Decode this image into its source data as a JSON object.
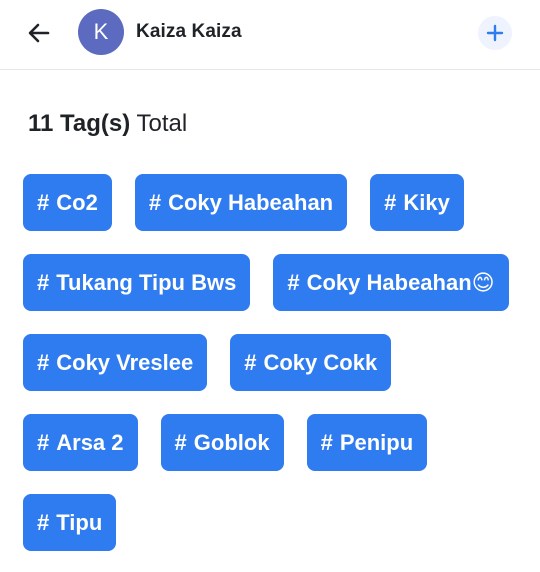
{
  "header": {
    "avatar_letter": "K",
    "username": "Kaiza Kaiza",
    "colors": {
      "avatar": "#5c6bc0",
      "accent": "#2f7bf0"
    }
  },
  "summary": {
    "count_text": "11 Tag(s)",
    "suffix": "Total"
  },
  "tags": [
    "Co2",
    "Coky Habeahan",
    "Kiky",
    "Tukang Tipu Bws",
    "Coky Habeahan😊",
    "Coky Vreslee",
    "Coky Cokk",
    "Arsa 2",
    "Goblok",
    "Penipu",
    "Tipu"
  ],
  "tag_prefix": "#"
}
